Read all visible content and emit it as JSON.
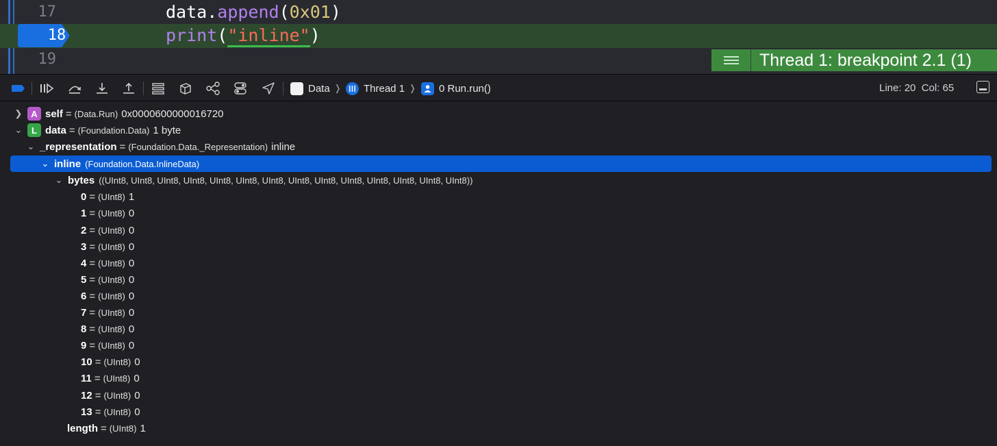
{
  "editor": {
    "lines": [
      {
        "number": "17",
        "code": "data.append(0x01)"
      },
      {
        "number": "18",
        "code": "print(\"inline\")"
      },
      {
        "number": "19",
        "code": ""
      }
    ],
    "line17": {
      "ident": "data",
      "dot": ".",
      "fn": "append",
      "open": "(",
      "num": "0x01",
      "close": ")"
    },
    "line18": {
      "fn": "print",
      "open": "(",
      "str": "\"inline\"",
      "close": ")"
    },
    "thread_badge": "Thread 1: breakpoint 2.1 (1)",
    "colors": {
      "breakpoint": "#1a6fe0",
      "current_line": "#2d4a2e",
      "badge": "#3d8a3f"
    }
  },
  "debug_bar": {
    "icons": [
      "breakpoints-toggle-icon",
      "continue-icon",
      "step-over-icon",
      "step-into-icon",
      "step-out-icon",
      "view-hierarchy-icon",
      "memory-graph-icon",
      "environment-overrides-icon",
      "simulate-location-icon",
      "location-arrow-icon"
    ],
    "breadcrumbs": [
      {
        "icon": "app-icon",
        "label": "Data"
      },
      {
        "icon": "thread-icon",
        "label": "Thread 1"
      },
      {
        "icon": "frame-icon",
        "label": "0 Run.run()"
      }
    ],
    "status": "Line: 20  Col: 65"
  },
  "variables": [
    {
      "name": "self",
      "type": "(Data.Run)",
      "value": "0x0000600000016720",
      "badge": "A",
      "disclosure": "collapsed"
    },
    {
      "name": "data",
      "type": "(Foundation.Data)",
      "value": "1 byte",
      "badge": "L",
      "disclosure": "expanded"
    },
    {
      "name": "_representation",
      "type": "(Foundation.Data._Representation)",
      "value": "inline",
      "disclosure": "expanded"
    },
    {
      "name": "inline",
      "type": "(Foundation.Data.InlineData)",
      "value": "",
      "disclosure": "expanded",
      "selected": true
    },
    {
      "name": "bytes",
      "type": "((UInt8, UInt8, UInt8, UInt8, UInt8, UInt8, UInt8, UInt8, UInt8, UInt8, UInt8, UInt8, UInt8, UInt8))",
      "value": "",
      "disclosure": "expanded"
    },
    {
      "name": "0",
      "type": "(UInt8)",
      "value": "1"
    },
    {
      "name": "1",
      "type": "(UInt8)",
      "value": "0"
    },
    {
      "name": "2",
      "type": "(UInt8)",
      "value": "0"
    },
    {
      "name": "3",
      "type": "(UInt8)",
      "value": "0"
    },
    {
      "name": "4",
      "type": "(UInt8)",
      "value": "0"
    },
    {
      "name": "5",
      "type": "(UInt8)",
      "value": "0"
    },
    {
      "name": "6",
      "type": "(UInt8)",
      "value": "0"
    },
    {
      "name": "7",
      "type": "(UInt8)",
      "value": "0"
    },
    {
      "name": "8",
      "type": "(UInt8)",
      "value": "0"
    },
    {
      "name": "9",
      "type": "(UInt8)",
      "value": "0"
    },
    {
      "name": "10",
      "type": "(UInt8)",
      "value": "0"
    },
    {
      "name": "11",
      "type": "(UInt8)",
      "value": "0"
    },
    {
      "name": "12",
      "type": "(UInt8)",
      "value": "0"
    },
    {
      "name": "13",
      "type": "(UInt8)",
      "value": "0"
    },
    {
      "name": "length",
      "type": "(UInt8)",
      "value": "1"
    }
  ]
}
